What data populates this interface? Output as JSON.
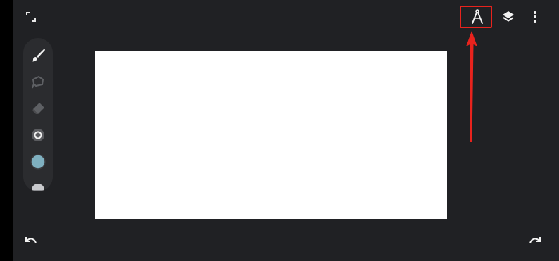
{
  "app": {
    "background": "#202124",
    "canvas_color": "#ffffff"
  },
  "top_bar": {
    "fullscreen_icon": "fullscreen-icon",
    "ruler_icon": "compass-ruler-icon",
    "layers_icon": "layers-icon",
    "more_icon": "more-vert-icon"
  },
  "tools": [
    {
      "name": "brush-tool",
      "icon": "brush-icon",
      "state": "active"
    },
    {
      "name": "lasso-tool",
      "icon": "lasso-icon",
      "state": "disabled"
    },
    {
      "name": "eraser-tool",
      "icon": "eraser-icon",
      "state": "disabled"
    },
    {
      "name": "brush-size-tool",
      "icon": "brush-size-icon",
      "state": "enabled"
    },
    {
      "name": "color-picker",
      "icon": "color-swatch",
      "color": "#7fb0c0"
    },
    {
      "name": "opacity-tool",
      "icon": "opacity-icon",
      "state": "partially-visible"
    }
  ],
  "bottom_bar": {
    "undo_icon": "undo-icon",
    "redo_icon": "redo-icon"
  },
  "annotation": {
    "highlight_color": "#e8231d"
  }
}
